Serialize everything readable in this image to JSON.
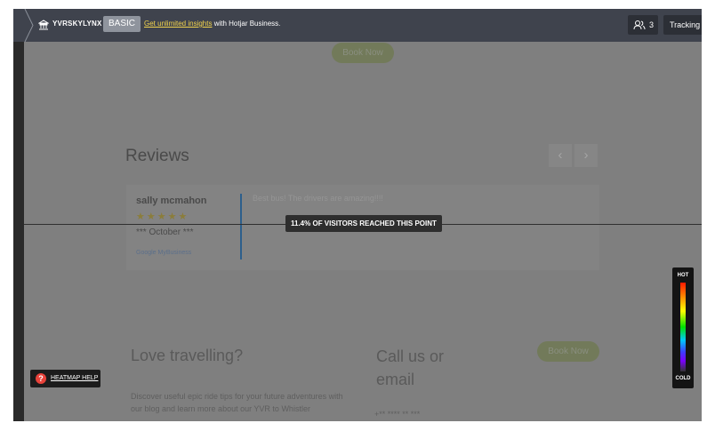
{
  "topbar": {
    "site_name": "YVRSKYLYNX",
    "plan_badge": "BASIC",
    "promo_link": "Get unlimited insights",
    "promo_rest": " with Hotjar Business.",
    "users_count": "3",
    "tracking_label": "Tracking"
  },
  "page": {
    "book_now_top": "Book Now",
    "reviews_title": "Reviews",
    "nav_prev": "‹",
    "nav_next": "›",
    "review": {
      "author": "sally mcmahon",
      "rating": 5,
      "stars": "★★★★★",
      "date": "*** October ***",
      "source": "Google MyBusiness",
      "text": "Best bus! The drivers are amazing!!!!"
    },
    "love_title": "Love travelling?",
    "love_text": "Discover useful epic ride tips for your future adventures with our blog and learn more about our YVR to Whistler",
    "call_title": "Call us or email",
    "call_phone": "+** **** ** ***",
    "book_now_bottom": "Book Now"
  },
  "heatmap": {
    "fold_label": "11.4% OF VISITORS REACHED THIS POINT",
    "fold_percent": 11.4,
    "help_label": "HEATMAP HELP",
    "help_icon": "?",
    "legend_hot": "HOT",
    "legend_cold": "COLD"
  },
  "colors": {
    "topbar": "#3f434d",
    "promo_link": "#f2d34d",
    "help_icon": "#e8423a",
    "overlay": "#7f7f7f"
  }
}
